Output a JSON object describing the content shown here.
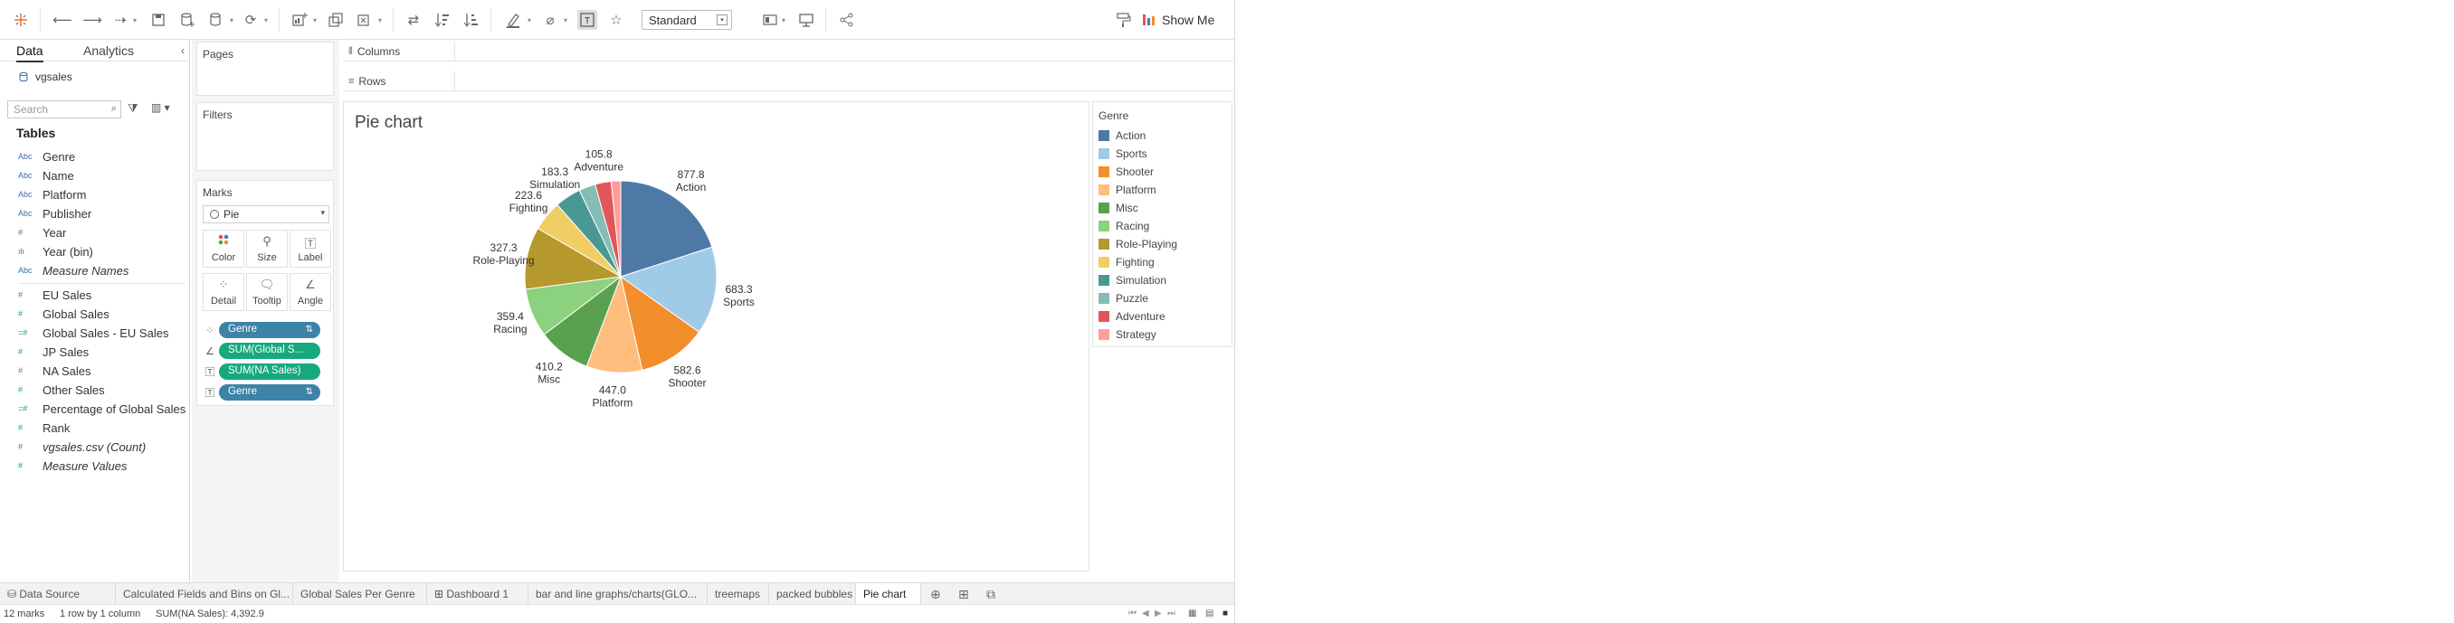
{
  "toolbar": {
    "mark_size_select": "Standard",
    "show_me_label": "Show Me"
  },
  "data_pane": {
    "tabs": [
      "Data",
      "Analytics"
    ],
    "datasource": "vgsales",
    "search_placeholder": "Search",
    "tables_heading": "Tables",
    "fields": [
      {
        "type": "Abc",
        "name": "Genre",
        "kind": "dimension"
      },
      {
        "type": "Abc",
        "name": "Name",
        "kind": "dimension"
      },
      {
        "type": "Abc",
        "name": "Platform",
        "kind": "dimension"
      },
      {
        "type": "Abc",
        "name": "Publisher",
        "kind": "dimension"
      },
      {
        "type": "#",
        "name": "Year",
        "kind": "dimension"
      },
      {
        "type": "ılı",
        "name": "Year (bin)",
        "kind": "dimension"
      },
      {
        "type": "Abc",
        "name": "Measure Names",
        "kind": "dimension-italic"
      },
      {
        "type": "#",
        "name": "EU Sales",
        "kind": "measure"
      },
      {
        "type": "#",
        "name": "Global Sales",
        "kind": "measure"
      },
      {
        "type": "=#",
        "name": "Global Sales - EU Sales",
        "kind": "measure"
      },
      {
        "type": "#",
        "name": "JP Sales",
        "kind": "measure"
      },
      {
        "type": "#",
        "name": "NA Sales",
        "kind": "measure"
      },
      {
        "type": "#",
        "name": "Other Sales",
        "kind": "measure"
      },
      {
        "type": "=#",
        "name": "Percentage of Global Sales",
        "kind": "measure"
      },
      {
        "type": "#",
        "name": "Rank",
        "kind": "measure"
      },
      {
        "type": "#",
        "name": "vgsales.csv (Count)",
        "kind": "measure-italic"
      },
      {
        "type": "#",
        "name": "Measure Values",
        "kind": "measure-italic"
      }
    ]
  },
  "shelves": {
    "pages_label": "Pages",
    "filters_label": "Filters",
    "marks_label": "Marks",
    "marks_type": "Pie",
    "mark_buttons": [
      "Color",
      "Size",
      "Label",
      "Detail",
      "Tooltip",
      "Angle"
    ],
    "pills": [
      {
        "icon": "color",
        "label": "Genre",
        "kind": "dim",
        "sorted": true
      },
      {
        "icon": "angle",
        "label": "SUM(Global S...",
        "kind": "meas",
        "sorted": false
      },
      {
        "icon": "label",
        "label": "SUM(NA Sales)",
        "kind": "meas",
        "sorted": false
      },
      {
        "icon": "label",
        "label": "Genre",
        "kind": "dim",
        "sorted": true
      }
    ],
    "columns_label": "Columns",
    "rows_label": "Rows"
  },
  "sheet": {
    "title": "Pie chart"
  },
  "chart_data": {
    "type": "pie",
    "title": "Pie chart",
    "legend_title": "Genre",
    "legend_position": "right",
    "angle_measure": "SUM(Global Sales)",
    "label_measure": "SUM(NA Sales)",
    "slices": [
      {
        "genre": "Action",
        "label_value": 877.8,
        "angle_share": 0.2,
        "color": "#4e79a7"
      },
      {
        "genre": "Sports",
        "label_value": 683.3,
        "angle_share": 0.148,
        "color": "#a0cbe8"
      },
      {
        "genre": "Shooter",
        "label_value": 582.6,
        "angle_share": 0.116,
        "color": "#f28e2b"
      },
      {
        "genre": "Platform",
        "label_value": 447.0,
        "angle_share": 0.094,
        "color": "#ffbe7d"
      },
      {
        "genre": "Misc",
        "label_value": 410.2,
        "angle_share": 0.089,
        "color": "#59a14f"
      },
      {
        "genre": "Racing",
        "label_value": 359.4,
        "angle_share": 0.082,
        "color": "#8cd17d"
      },
      {
        "genre": "Role-Playing",
        "label_value": 327.3,
        "angle_share": 0.105,
        "color": "#b6992d"
      },
      {
        "genre": "Fighting",
        "label_value": 223.6,
        "angle_share": 0.051,
        "color": "#f1ce63"
      },
      {
        "genre": "Simulation",
        "label_value": 183.3,
        "angle_share": 0.044,
        "color": "#499894"
      },
      {
        "genre": "Puzzle",
        "label_value": null,
        "angle_share": 0.028,
        "color": "#86bcb6"
      },
      {
        "genre": "Adventure",
        "label_value": 105.8,
        "angle_share": 0.027,
        "color": "#e15759"
      },
      {
        "genre": "Strategy",
        "label_value": null,
        "angle_share": 0.016,
        "color": "#ff9d9a"
      }
    ]
  },
  "tabs": [
    {
      "label": "Data Source",
      "active": false
    },
    {
      "label": "Calculated Fields and Bins on Gl...",
      "active": false
    },
    {
      "label": "Global Sales Per Genre",
      "active": false
    },
    {
      "label": "Dashboard 1",
      "active": false
    },
    {
      "label": "bar and line graphs/charts(GLO...",
      "active": false
    },
    {
      "label": "treemaps",
      "active": false
    },
    {
      "label": "packed bubbles",
      "active": false
    },
    {
      "label": "Pie chart",
      "active": true
    }
  ],
  "status": {
    "marks": "12 marks",
    "dims": "1 row by 1 column",
    "sum": "SUM(NA Sales): 4,392.9"
  }
}
